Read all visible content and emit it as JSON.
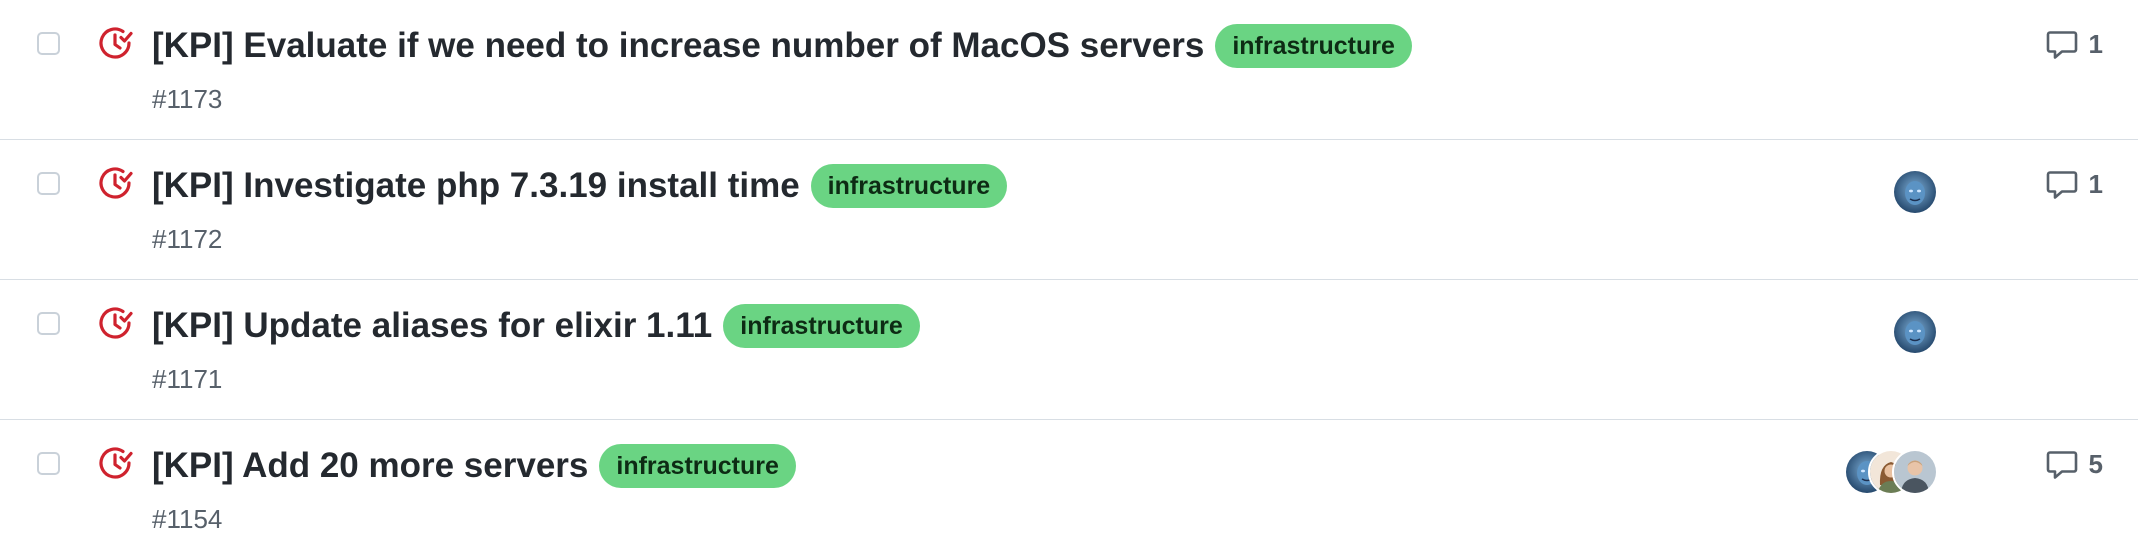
{
  "issues": [
    {
      "title": "[KPI] Evaluate if we need to increase number of MacOS servers",
      "label": "infrastructure",
      "number": "#1173",
      "assignees": [],
      "comments": "1"
    },
    {
      "title": "[KPI] Investigate php 7.3.19 install time",
      "label": "infrastructure",
      "number": "#1172",
      "assignees": [
        "blue-avatar"
      ],
      "comments": "1"
    },
    {
      "title": "[KPI] Update aliases for elixir 1.11",
      "label": "infrastructure",
      "number": "#1171",
      "assignees": [
        "blue-avatar"
      ],
      "comments": ""
    },
    {
      "title": "[KPI] Add 20 more servers",
      "label": "infrastructure",
      "number": "#1154",
      "assignees": [
        "blue-avatar",
        "woman-avatar",
        "man-avatar"
      ],
      "comments": "5"
    }
  ],
  "colors": {
    "label_bg": "#6ad483",
    "state_icon": "#cf222e",
    "muted_text": "#57606a"
  },
  "icons": {
    "state": "issue-draft-closed-icon",
    "comment": "comment-icon"
  }
}
